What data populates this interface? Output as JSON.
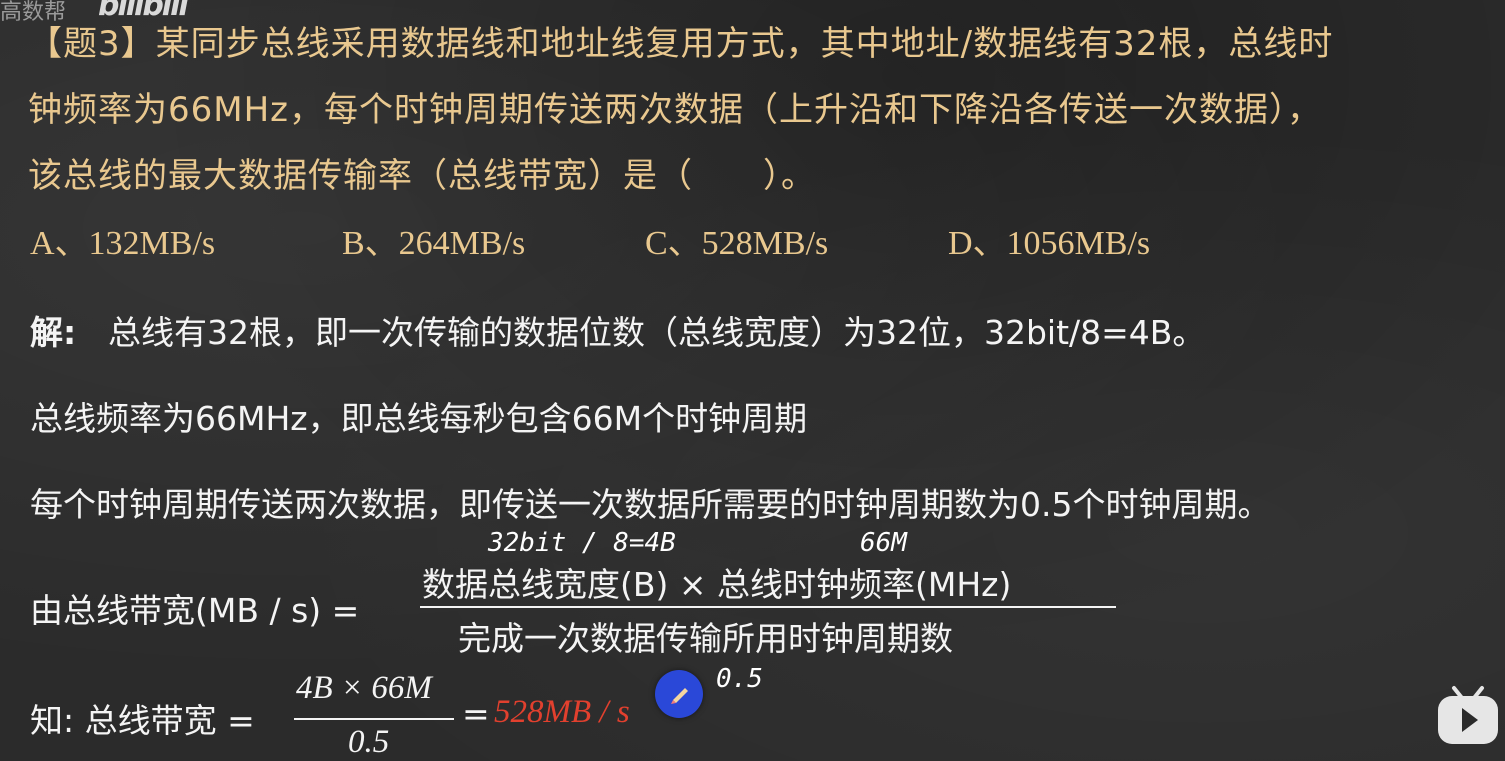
{
  "watermark": {
    "channel": "高数帮",
    "logo": "bilibili"
  },
  "question": {
    "line1": "【题3】某同步总线采用数据线和地址线复用方式，其中地址/数据线有32根，总线时",
    "line2": "钟频率为66MHz，每个时钟周期传送两次数据（上升沿和下降沿各传送一次数据），",
    "line3": "该总线的最大数据传输率（总线带宽）是（　　）。"
  },
  "options": [
    {
      "label": "A、132MB/s"
    },
    {
      "label": "B、264MB/s"
    },
    {
      "label": "C、528MB/s"
    },
    {
      "label": "D、1056MB/s"
    }
  ],
  "solution": {
    "prefix": "解:",
    "line1": "总线有32根，即一次传输的数据位数（总线宽度）为32位，32bit/8=4B。",
    "line2": "总线频率为66MHz，即总线每秒包含66M个时钟周期",
    "line3": "每个时钟周期传送两次数据，即传送一次数据所需要的时钟周期数为0.5个时钟周期。"
  },
  "formula": {
    "lhs": "由总线带宽(MB / s) =",
    "numerator": "数据总线宽度(B) × 总线时钟频率(MHz)",
    "denominator": "完成一次数据传输所用时钟周期数",
    "note_width": "32bit / 8=4B",
    "note_freq": "66M"
  },
  "result": {
    "lhs": "知: 总线带宽 =",
    "numerator": "4B × 66M",
    "denominator": "0.5",
    "equals": "=",
    "value": "528MB / s",
    "note": "0.5"
  },
  "colors": {
    "question": "#e9c88f",
    "answer": "#e2402e",
    "pen": "#2a48d8"
  },
  "icons": {
    "pen": "pen-icon",
    "play": "play-icon"
  }
}
